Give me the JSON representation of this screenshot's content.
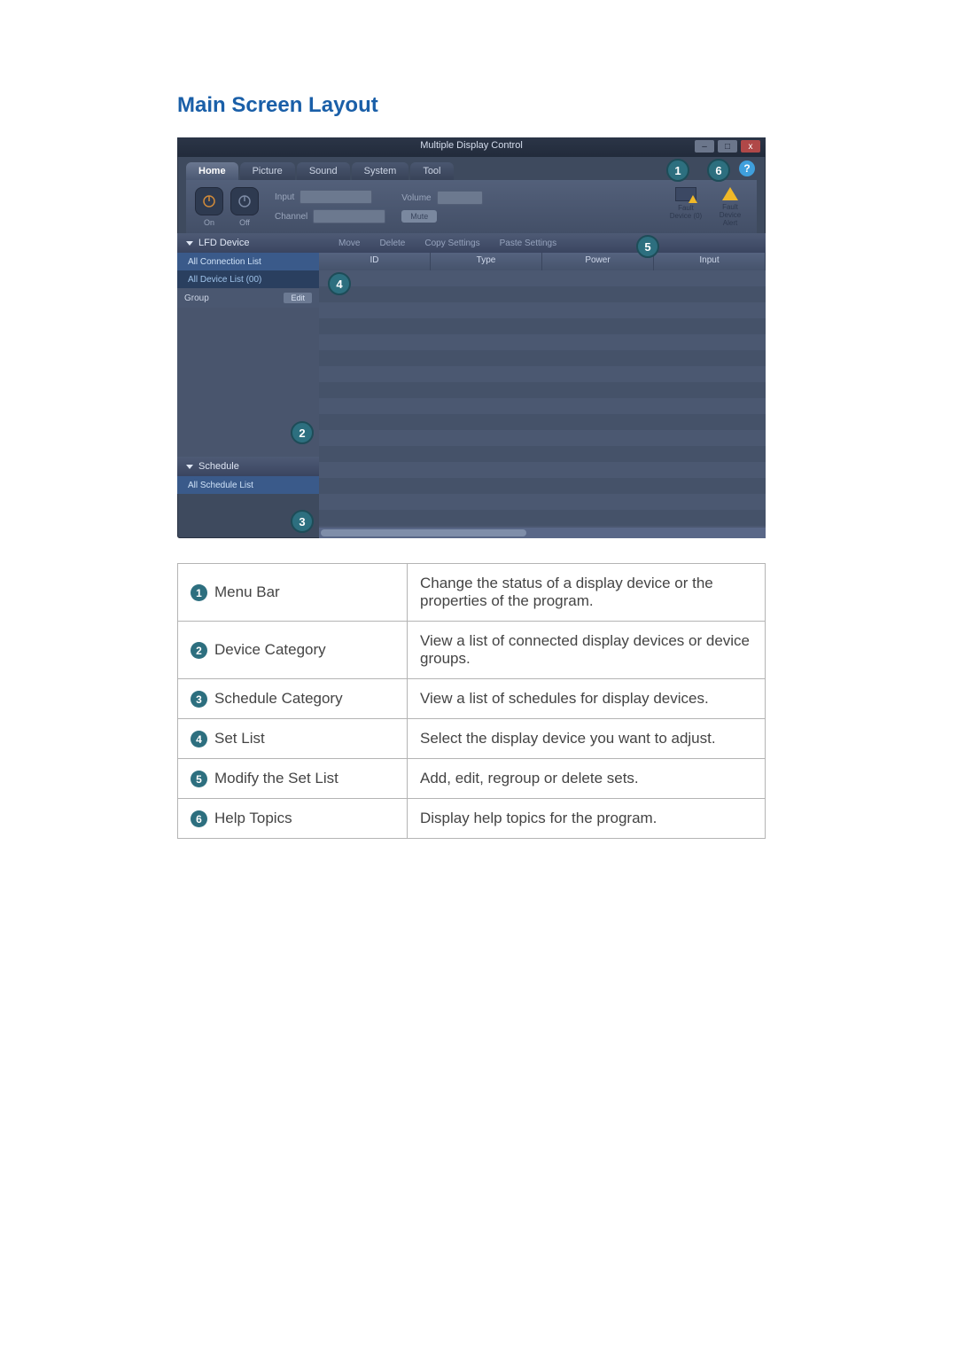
{
  "heading": "Main Screen Layout",
  "window": {
    "title": "Multiple Display Control",
    "tabs": [
      "Home",
      "Picture",
      "Sound",
      "System",
      "Tool"
    ],
    "power_on": "On",
    "power_off": "Off",
    "input_label": "Input",
    "channel_label": "Channel",
    "volume_label": "Volume",
    "mute": "Mute",
    "fault_count": "Fault Device (0)",
    "fault_alert": "Fault Device Alert",
    "help_glyph": "?",
    "win_min": "–",
    "win_max": "□",
    "win_close": "x"
  },
  "left": {
    "lfd": "LFD Device",
    "all_conn": "All Connection List",
    "all_dev": "All Device List (00)",
    "group": "Group",
    "edit": "Edit",
    "schedule": "Schedule",
    "all_sched": "All Schedule List"
  },
  "toolbar2": {
    "move": "Move",
    "delete": "Delete",
    "copy": "Copy Settings",
    "paste": "Paste Settings"
  },
  "cols": {
    "id": "ID",
    "type": "Type",
    "power": "Power",
    "input": "Input"
  },
  "callouts": {
    "c1": "1",
    "c2": "2",
    "c3": "3",
    "c4": "4",
    "c5": "5",
    "c6": "6"
  },
  "legend": [
    {
      "n": "1",
      "label": "Menu Bar",
      "desc": "Change the status of a display device or the properties of the program."
    },
    {
      "n": "2",
      "label": "Device Category",
      "desc": "View a list of connected display devices or device groups."
    },
    {
      "n": "3",
      "label": "Schedule Category",
      "desc": "View a list of schedules for display devices."
    },
    {
      "n": "4",
      "label": "Set List",
      "desc": "Select the display device you want to adjust."
    },
    {
      "n": "5",
      "label": "Modify the Set List",
      "desc": "Add, edit, regroup or delete sets."
    },
    {
      "n": "6",
      "label": "Help Topics",
      "desc": "Display help topics for the program."
    }
  ]
}
